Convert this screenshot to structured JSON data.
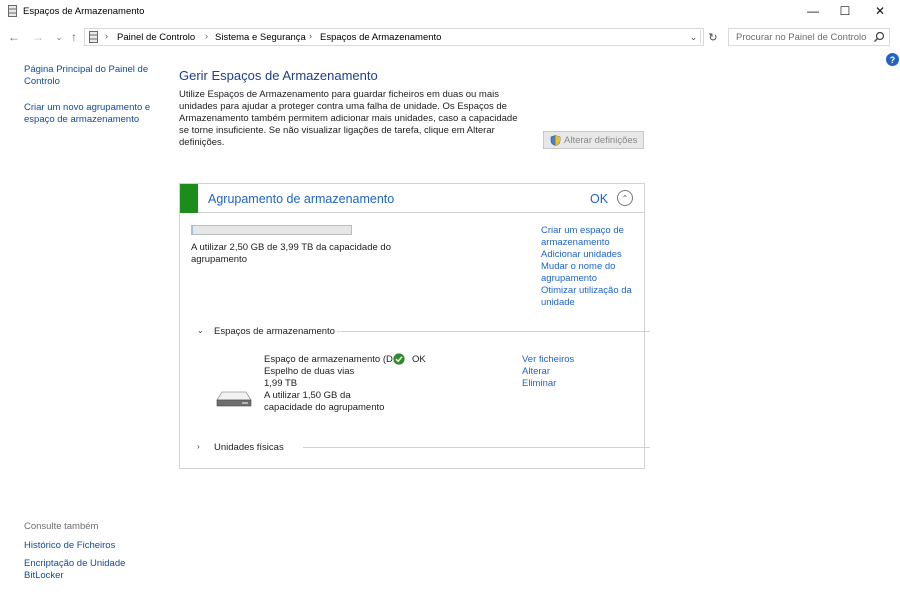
{
  "window": {
    "title": "Espaços de Armazenamento",
    "controls": [
      "minimize-icon",
      "maximize-icon",
      "close-icon"
    ]
  },
  "addressbar": {
    "breadcrumb": [
      "Painel de Controlo",
      "Sistema e Segurança",
      "Espaços de Armazenamento"
    ],
    "search_placeholder": "Procurar no Painel de Controlo"
  },
  "help_label": "?",
  "sidebar": {
    "links": [
      "Página Principal do Painel de Controlo",
      "Criar um novo agrupamento e espaço de armazenamento"
    ],
    "see_also_label": "Consulte também",
    "see_also": [
      "Histórico de Ficheiros",
      "Encriptação de Unidade BitLocker"
    ]
  },
  "main": {
    "heading": "Gerir Espaços de Armazenamento",
    "description": "Utilize Espaços de Armazenamento para guardar ficheiros em duas ou mais unidades para ajudar a proteger contra uma falha de unidade. Os Espaços de Armazenamento também permitem adicionar mais unidades, caso a capacidade se torne insuficiente. Se não visualizar ligações de tarefa, clique em Alterar definições.",
    "change_settings_label": "Alterar definições"
  },
  "pool": {
    "title": "Agrupamento de armazenamento",
    "status": "OK",
    "usage_text": "A utilizar 2,50 GB de 3,99 TB da capacidade do agrupamento",
    "usage_fraction": 0.000627,
    "links": [
      "Criar um espaço de armazenamento",
      "Adicionar unidades",
      "Mudar o nome do agrupamento",
      "Otimizar utilização da unidade"
    ],
    "spaces_section_label": "Espaços de armazenamento",
    "space": {
      "name": "Espaço de armazenamento (D:)",
      "status": "OK",
      "resiliency": "Espelho de duas vias",
      "size": "1,99 TB",
      "usage": "A utilizar 1,50 GB da capacidade do agrupamento",
      "links": [
        "Ver ficheiros",
        "Alterar",
        "Eliminar"
      ]
    },
    "physical_section_label": "Unidades físicas"
  },
  "colors": {
    "link": "#1e64c8",
    "heading": "#1e3f8a",
    "status_green": "#1c8c1c"
  }
}
